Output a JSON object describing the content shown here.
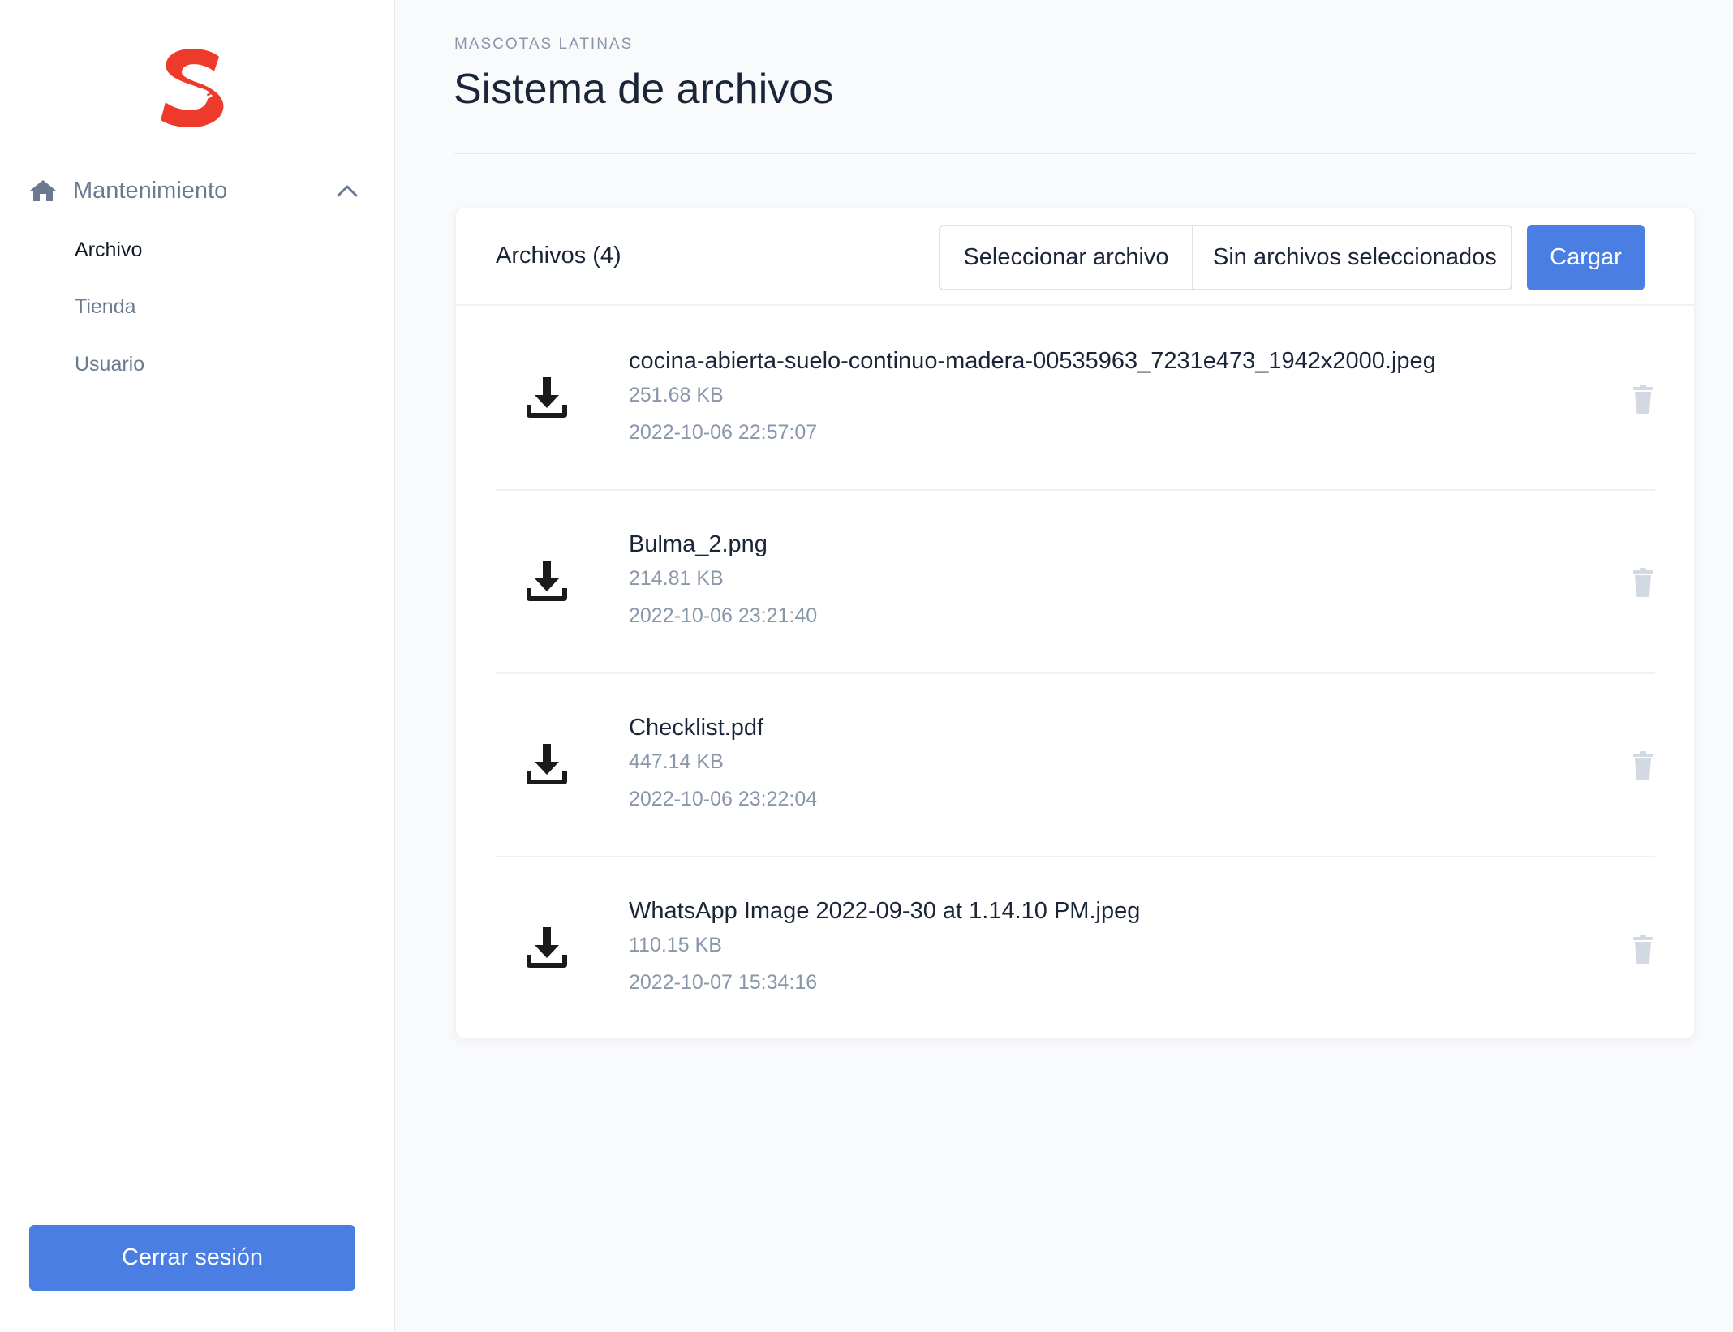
{
  "sidebar": {
    "logo_letter": "S",
    "section_label": "Mantenimiento",
    "items": [
      {
        "label": "Archivo",
        "active": true
      },
      {
        "label": "Tienda",
        "active": false
      },
      {
        "label": "Usuario",
        "active": false
      }
    ],
    "logout_label": "Cerrar sesión"
  },
  "header": {
    "eyebrow": "MASCOTAS LATINAS",
    "title": "Sistema de archivos"
  },
  "card": {
    "title": "Archivos (4)",
    "select_file_label": "Seleccionar archivo",
    "no_file_label": "Sin archivos seleccionados",
    "upload_label": "Cargar"
  },
  "files": [
    {
      "name": "cocina-abierta-suelo-continuo-madera-00535963_7231e473_1942x2000.jpeg",
      "size": "251.68 KB",
      "date": "2022-10-06 22:57:07"
    },
    {
      "name": "Bulma_2.png",
      "size": "214.81 KB",
      "date": "2022-10-06 23:21:40"
    },
    {
      "name": "Checklist.pdf",
      "size": "447.14 KB",
      "date": "2022-10-06 23:22:04"
    },
    {
      "name": "WhatsApp Image 2022-09-30 at 1.14.10 PM.jpeg",
      "size": "110.15 KB",
      "date": "2022-10-07 15:34:16"
    }
  ],
  "icons": {
    "logo": "s-hand-logo",
    "home": "home-icon",
    "chevron": "chevron-up-icon",
    "download": "download-icon",
    "trash": "trash-icon"
  },
  "colors": {
    "primary": "#4a7ee3",
    "logo_red": "#ee3a2a",
    "muted_text": "#8a97ab",
    "trash_gray": "#d3d9e2"
  }
}
